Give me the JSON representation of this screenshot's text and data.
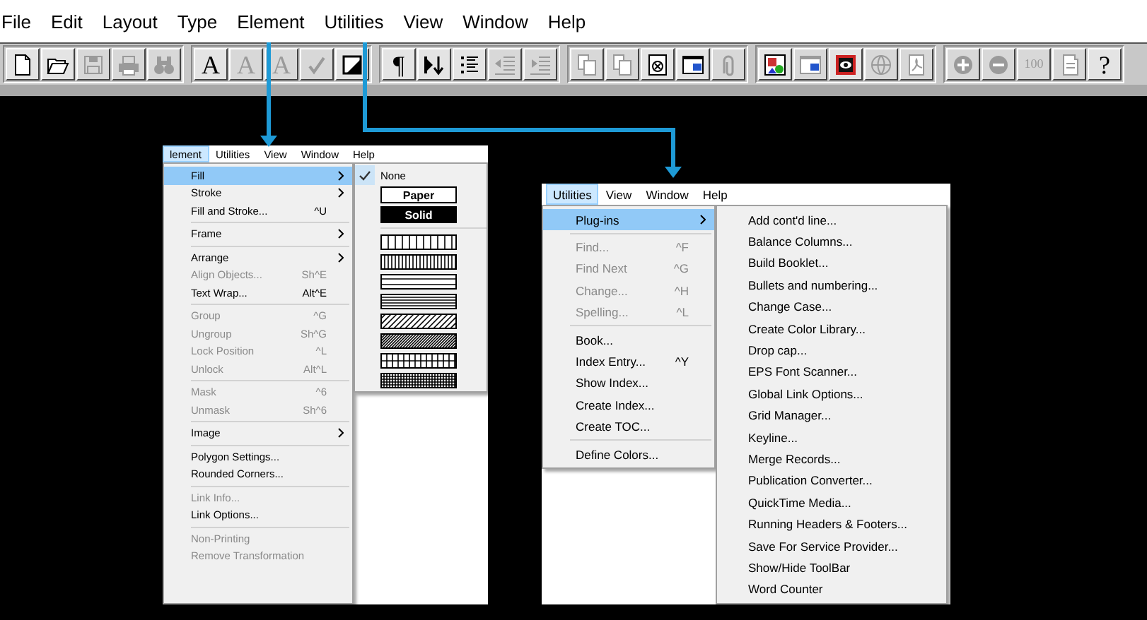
{
  "menu_bar": [
    {
      "label": "File"
    },
    {
      "label": "Edit"
    },
    {
      "label": "Layout"
    },
    {
      "label": "Type"
    },
    {
      "label": "Element"
    },
    {
      "label": "Utilities"
    },
    {
      "label": "View"
    },
    {
      "label": "Window"
    },
    {
      "label": "Help"
    }
  ],
  "toolbar": {
    "groups": [
      {
        "buttons": [
          {
            "kind": "doc",
            "disabled": false
          },
          {
            "kind": "folder",
            "disabled": false
          },
          {
            "kind": "disk",
            "disabled": true
          },
          {
            "kind": "printer",
            "disabled": true
          },
          {
            "kind": "binoculars",
            "disabled": true
          }
        ]
      },
      {
        "buttons": [
          {
            "kind": "glyph",
            "glyph": "A",
            "disabled": false
          },
          {
            "kind": "glyph",
            "glyph": "A",
            "disabled": true
          },
          {
            "kind": "glyph",
            "glyph": "A",
            "disabled": true
          },
          {
            "kind": "check",
            "disabled": true
          },
          {
            "kind": "frame",
            "disabled": false
          }
        ]
      },
      {
        "buttons": [
          {
            "kind": "glyph",
            "glyph": "¶",
            "disabled": false
          },
          {
            "kind": "flow",
            "disabled": false
          },
          {
            "kind": "list",
            "disabled": false
          },
          {
            "kind": "outdent",
            "disabled": true
          },
          {
            "kind": "indent",
            "disabled": true
          }
        ]
      },
      {
        "buttons": [
          {
            "kind": "pages",
            "disabled": true
          },
          {
            "kind": "pages",
            "disabled": true
          },
          {
            "kind": "docx",
            "disabled": false
          },
          {
            "kind": "window",
            "disabled": false
          },
          {
            "kind": "clip",
            "disabled": true
          }
        ]
      },
      {
        "buttons": [
          {
            "kind": "picture",
            "disabled": false
          },
          {
            "kind": "window",
            "disabled": true
          },
          {
            "kind": "eye",
            "disabled": false
          },
          {
            "kind": "globe",
            "disabled": true
          },
          {
            "kind": "pdf",
            "disabled": true
          }
        ]
      },
      {
        "buttons": [
          {
            "kind": "plus",
            "disabled": true
          },
          {
            "kind": "minus",
            "disabled": true
          },
          {
            "kind": "glyph",
            "glyph": "100",
            "disabled": true
          },
          {
            "kind": "page",
            "disabled": true
          },
          {
            "kind": "glyph",
            "glyph": "?",
            "disabled": false
          }
        ]
      }
    ]
  },
  "element_menu_screenshot": {
    "menu_bar": [
      {
        "label": "lement",
        "selected": true
      },
      {
        "label": "Utilities",
        "selected": false
      },
      {
        "label": "View",
        "selected": false
      },
      {
        "label": "Window",
        "selected": false
      },
      {
        "label": "Help",
        "selected": false
      }
    ],
    "menu": [
      {
        "kind": "item",
        "label": "Fill",
        "selected": true,
        "disabled": false,
        "submenu": true
      },
      {
        "kind": "item",
        "label": "Stroke",
        "selected": false,
        "disabled": false,
        "submenu": true
      },
      {
        "kind": "item",
        "label": "Fill and Stroke...",
        "shortcut": "^U",
        "selected": false,
        "disabled": false,
        "submenu": false
      },
      {
        "kind": "separator"
      },
      {
        "kind": "item",
        "label": "Frame",
        "selected": false,
        "disabled": false,
        "submenu": true
      },
      {
        "kind": "separator"
      },
      {
        "kind": "item",
        "label": "Arrange",
        "selected": false,
        "disabled": false,
        "submenu": true
      },
      {
        "kind": "item",
        "label": "Align Objects...",
        "shortcut": "Sh^E",
        "selected": false,
        "disabled": true,
        "submenu": false
      },
      {
        "kind": "item",
        "label": "Text Wrap...",
        "shortcut": "Alt^E",
        "selected": false,
        "disabled": false,
        "submenu": false
      },
      {
        "kind": "separator"
      },
      {
        "kind": "item",
        "label": "Group",
        "shortcut": "^G",
        "selected": false,
        "disabled": true,
        "submenu": false
      },
      {
        "kind": "item",
        "label": "Ungroup",
        "shortcut": "Sh^G",
        "selected": false,
        "disabled": true,
        "submenu": false
      },
      {
        "kind": "item",
        "label": "Lock Position",
        "shortcut": "^L",
        "selected": false,
        "disabled": true,
        "submenu": false
      },
      {
        "kind": "item",
        "label": "Unlock",
        "shortcut": "Alt^L",
        "selected": false,
        "disabled": true,
        "submenu": false
      },
      {
        "kind": "separator"
      },
      {
        "kind": "item",
        "label": "Mask",
        "shortcut": "^6",
        "selected": false,
        "disabled": true,
        "submenu": false
      },
      {
        "kind": "item",
        "label": "Unmask",
        "shortcut": "Sh^6",
        "selected": false,
        "disabled": true,
        "submenu": false
      },
      {
        "kind": "separator"
      },
      {
        "kind": "item",
        "label": "Image",
        "selected": false,
        "disabled": false,
        "submenu": true
      },
      {
        "kind": "separator"
      },
      {
        "kind": "item",
        "label": "Polygon Settings...",
        "selected": false,
        "disabled": false,
        "submenu": false
      },
      {
        "kind": "item",
        "label": "Rounded Corners...",
        "selected": false,
        "disabled": false,
        "submenu": false
      },
      {
        "kind": "separator"
      },
      {
        "kind": "item",
        "label": "Link Info...",
        "selected": false,
        "disabled": true,
        "submenu": false
      },
      {
        "kind": "item",
        "label": "Link Options...",
        "selected": false,
        "disabled": false,
        "submenu": false
      },
      {
        "kind": "separator"
      },
      {
        "kind": "item",
        "label": "Non-Printing",
        "selected": false,
        "disabled": true,
        "submenu": false
      },
      {
        "kind": "item",
        "label": "Remove Transformation",
        "selected": false,
        "disabled": true,
        "submenu": false
      }
    ],
    "fill_submenu": [
      {
        "kind": "option",
        "label": "None",
        "checked": true
      },
      {
        "kind": "paper",
        "label": "Paper",
        "checked": false
      },
      {
        "kind": "solid",
        "label": "Solid",
        "checked": false
      },
      {
        "kind": "separator"
      },
      {
        "kind": "vertical",
        "checked": false
      },
      {
        "kind": "vertical-dense",
        "checked": false
      },
      {
        "kind": "horizontal-wide",
        "checked": false
      },
      {
        "kind": "horizontal",
        "checked": false
      },
      {
        "kind": "diagonal",
        "checked": false
      },
      {
        "kind": "diagonal-dense",
        "checked": false
      },
      {
        "kind": "grid",
        "checked": false
      },
      {
        "kind": "grid-dense",
        "checked": false
      }
    ]
  },
  "utilities_menu_screenshot": {
    "menu_bar": [
      {
        "label": "Utilities",
        "selected": true
      },
      {
        "label": "View",
        "selected": false
      },
      {
        "label": "Window",
        "selected": false
      },
      {
        "label": "Help",
        "selected": false
      }
    ],
    "menu": [
      {
        "kind": "item",
        "label": "Plug-ins",
        "selected": true,
        "disabled": false,
        "submenu": true
      },
      {
        "kind": "separator"
      },
      {
        "kind": "item",
        "label": "Find...",
        "shortcut": "^F",
        "selected": false,
        "disabled": true,
        "submenu": false
      },
      {
        "kind": "item",
        "label": "Find Next",
        "shortcut": "^G",
        "selected": false,
        "disabled": true,
        "submenu": false
      },
      {
        "kind": "item",
        "label": "Change...",
        "shortcut": "^H",
        "selected": false,
        "disabled": true,
        "submenu": false
      },
      {
        "kind": "item",
        "label": "Spelling...",
        "shortcut": "^L",
        "selected": false,
        "disabled": true,
        "submenu": false
      },
      {
        "kind": "separator"
      },
      {
        "kind": "item",
        "label": "Book...",
        "selected": false,
        "disabled": false,
        "submenu": false
      },
      {
        "kind": "item",
        "label": "Index Entry...",
        "shortcut": "^Y",
        "selected": false,
        "disabled": false,
        "submenu": false
      },
      {
        "kind": "item",
        "label": "Show Index...",
        "selected": false,
        "disabled": false,
        "submenu": false
      },
      {
        "kind": "item",
        "label": "Create Index...",
        "selected": false,
        "disabled": false,
        "submenu": false
      },
      {
        "kind": "item",
        "label": "Create TOC...",
        "selected": false,
        "disabled": false,
        "submenu": false
      },
      {
        "kind": "separator"
      },
      {
        "kind": "item",
        "label": "Define Colors...",
        "selected": false,
        "disabled": false,
        "submenu": false
      }
    ],
    "plugins_submenu": [
      {
        "label": "Add cont'd line...",
        "selected": false
      },
      {
        "label": "Balance Columns...",
        "selected": false
      },
      {
        "label": "Build Booklet...",
        "selected": false
      },
      {
        "label": "Bullets and numbering...",
        "selected": false
      },
      {
        "label": "Change Case...",
        "selected": false
      },
      {
        "label": "Create Color Library...",
        "selected": false
      },
      {
        "label": "Drop cap...",
        "selected": false
      },
      {
        "label": "EPS Font Scanner...",
        "selected": false
      },
      {
        "label": "Global Link Options...",
        "selected": false
      },
      {
        "label": "Grid Manager...",
        "selected": false
      },
      {
        "label": "Keyline...",
        "selected": false
      },
      {
        "label": "Merge Records...",
        "selected": false
      },
      {
        "label": "Publication Converter...",
        "selected": false
      },
      {
        "label": "QuickTime Media...",
        "selected": false
      },
      {
        "label": "Running Headers & Footers...",
        "selected": false
      },
      {
        "label": "Save For Service Provider...",
        "selected": false
      },
      {
        "label": "Show/Hide ToolBar",
        "selected": false
      },
      {
        "label": "Word Counter",
        "selected": false
      }
    ]
  }
}
